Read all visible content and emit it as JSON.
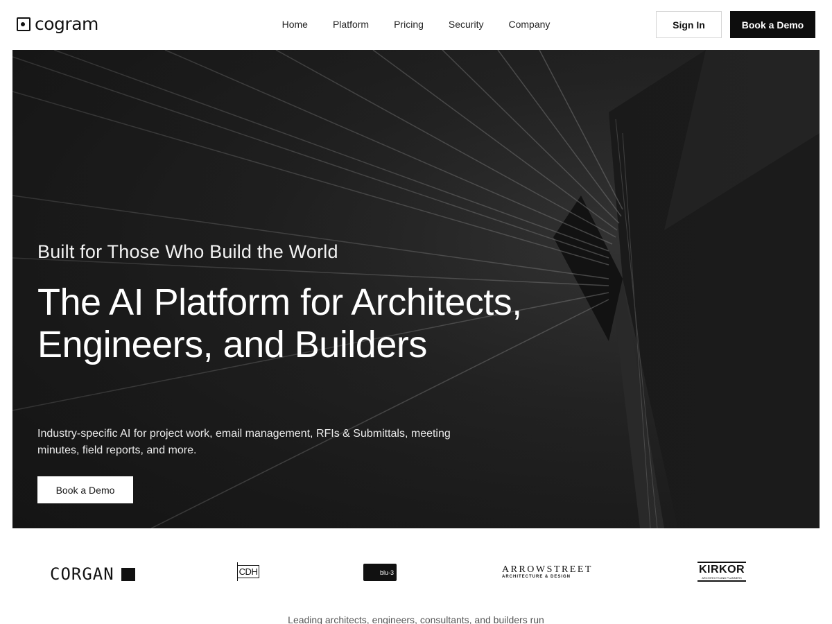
{
  "header": {
    "brand": "cogram",
    "nav": [
      "Home",
      "Platform",
      "Pricing",
      "Security",
      "Company"
    ],
    "signin_label": "Sign In",
    "demo_label": "Book a Demo"
  },
  "hero": {
    "eyebrow": "Built for Those Who Build the World",
    "headline": "The AI Platform for Architects, Engineers, and Builders",
    "subhead": "Industry-specific AI for project work, email management, RFIs & Submittals, meeting minutes, field reports, and more.",
    "cta_label": "Book a Demo"
  },
  "logos": {
    "corgan": "CORGAN",
    "cdh": "CDH",
    "blu": "blu-3",
    "arrowstreet": "ARROWSTREET",
    "arrowstreet_sub": "ARCHITECTURE & DESIGN",
    "kirkor": "KIRKOR",
    "kirkor_sub": "ARCHITECTS AND PLANNERS"
  },
  "tagline": "Leading architects, engineers, consultants, and builders run"
}
